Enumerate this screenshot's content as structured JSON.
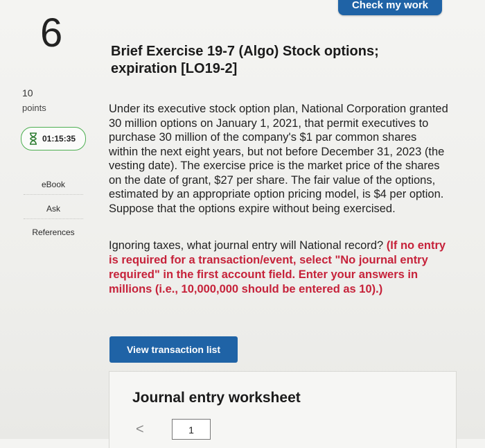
{
  "header": {
    "check_button": "Check my work"
  },
  "sidebar": {
    "question_number": "6",
    "points_value": "10",
    "points_label": "points",
    "timer": "01:15:35",
    "tools": [
      {
        "label": "eBook"
      },
      {
        "label": "Ask"
      },
      {
        "label": "References"
      }
    ]
  },
  "question": {
    "title_line1": "Brief Exercise 19-7 (Algo) Stock options;",
    "title_line2": "expiration [LO19-2]",
    "body": "Under its executive stock option plan, National Corporation granted 30 million options on January 1, 2021, that permit executives to purchase 30 million of the company's $1 par common shares within the next eight years, but not before December 31, 2023 (the vesting date). The exercise price is the market price of the shares on the date of grant, $27 per share. The fair value of the options, estimated by an appropriate option pricing model, is $4 per option. Suppose that the options expire without being exercised.",
    "prompt_plain": "Ignoring taxes, what journal entry will National record?",
    "prompt_instructions": "(If no entry is required for a transaction/event, select \"No journal entry required\" in the first account field. Enter your answers in millions (i.e., 10,000,000 should be entered as 10).)"
  },
  "actions": {
    "view_transactions": "View transaction list"
  },
  "worksheet": {
    "title": "Journal entry worksheet",
    "prev_arrow": "<",
    "page": "1"
  },
  "colors": {
    "primary_button": "#1f63a6",
    "instruction_red": "#c6223a",
    "timer_border": "#4caf50"
  }
}
